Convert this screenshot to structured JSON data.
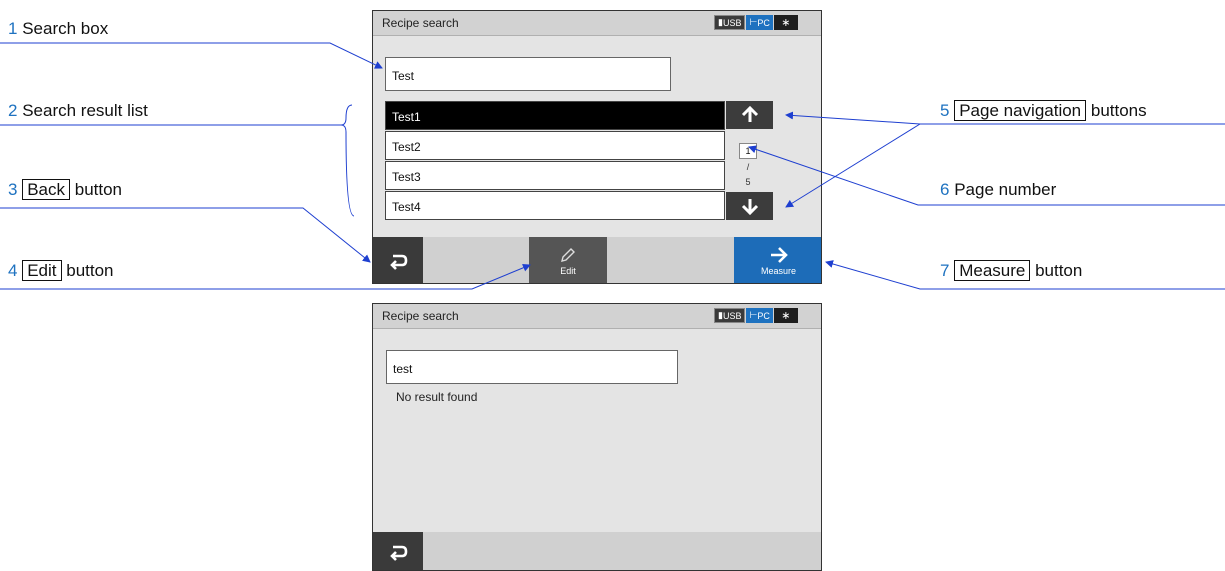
{
  "screen1": {
    "title": "Recipe search",
    "status": {
      "usb": "USB",
      "pc": "PC",
      "bluetooth": "bluetooth-icon"
    },
    "search_value": "Test",
    "results": [
      "Test1",
      "Test2",
      "Test3",
      "Test4"
    ],
    "page": {
      "current": "1",
      "separator": "/",
      "total": "5"
    },
    "edit_label": "Edit",
    "measure_label": "Measure"
  },
  "screen2": {
    "title": "Recipe search",
    "status": {
      "usb": "USB",
      "pc": "PC",
      "bluetooth": "bluetooth-icon"
    },
    "search_value": "test",
    "message": "No result found"
  },
  "callouts": {
    "c1": {
      "num": "1",
      "text": "Search box"
    },
    "c2": {
      "num": "2",
      "text": "Search result list"
    },
    "c3": {
      "num": "3",
      "boxed": "Back",
      "text": "button"
    },
    "c4": {
      "num": "4",
      "boxed": "Edit",
      "text": "button"
    },
    "c5": {
      "num": "5",
      "boxed": "Page navigation",
      "text": "buttons"
    },
    "c6": {
      "num": "6",
      "text": "Page number"
    },
    "c7": {
      "num": "7",
      "boxed": "Measure",
      "text": "button"
    }
  },
  "colors": {
    "accent": "#1e72c0",
    "selected_row": "#000000",
    "callout_line": "#1e3fd0"
  }
}
